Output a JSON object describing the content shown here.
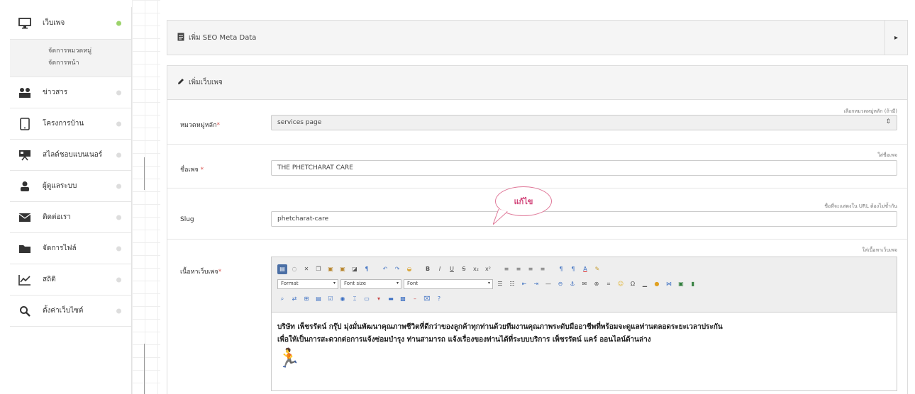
{
  "sidebar": {
    "items": [
      {
        "label": "เว็บเพจ",
        "icon": "monitor-icon"
      },
      {
        "label": "ข่าวสาร",
        "icon": "users-icon"
      },
      {
        "label": "โครงการบ้าน",
        "icon": "tablet-icon"
      },
      {
        "label": "สไลด์ชอบแบนเนอร์",
        "icon": "presentation-icon"
      },
      {
        "label": "ผู้ดูแลระบบ",
        "icon": "user-icon"
      },
      {
        "label": "ติดต่อเรา",
        "icon": "envelope-icon"
      },
      {
        "label": "จัดการไฟล์",
        "icon": "folder-icon"
      },
      {
        "label": "สถิติ",
        "icon": "chart-line-icon"
      },
      {
        "label": "ตั้งค่าเว็บไซต์",
        "icon": "settings-search-icon"
      }
    ],
    "submenu": [
      "จัดการหมวดหมู่",
      "จัดการหน้า"
    ]
  },
  "seo_panel": {
    "title": "เพิ่ม SEO Meta Data",
    "toggle": "▸"
  },
  "page_panel": {
    "title": "เพิ่มเว็บเพจ"
  },
  "form": {
    "category": {
      "label": "หมวดหมู่หลัก",
      "hint": "เลือกหมวดหมู่หลัก (ถ้ามี)",
      "value": "services page"
    },
    "name": {
      "label": "ชื่อเพจ",
      "hint": "ใส่ชื่อเพจ",
      "value": "THE PHETCHARAT CARE"
    },
    "slug": {
      "label": "Slug",
      "hint": "ชื่อที่จะแสดงใน URL ต้องไม่ซ้ำกัน",
      "value": "phetcharat-care"
    },
    "content": {
      "label": "เนื้อหาเว็บเพจ",
      "hint": "ใส่เนื้อหาเว็บเพจ",
      "line1": "บริษัท เพ็ชรรัตน์ กรุ๊ป มุ่งมั่นพัฒนาคุณภาพชีวิตที่ดีกว่าของลูกค้าทุกท่านด้วยทีมงานคุณภาพระดับมืออาชีพที่พร้อมจะดูแลท่านตลอดระยะเวลาประกัน",
      "line2": "เพื่อให้เป็นการสะดวกต่อการแจ้งซ่อมบำรุง ท่านสามารถ แจ้งเรื่องของท่านได้ที่ระบบบริการ เพ็ชรรัตน์ แคร์ ออนไลน์ด้านล่าง"
    }
  },
  "editor": {
    "format_label": "Format",
    "fontsize_label": "Font size",
    "font_label": "Font"
  },
  "callout": {
    "text": "แก้ไข"
  },
  "colors": {
    "accent_dot": "#9bd36a",
    "callout": "#d2457a"
  }
}
